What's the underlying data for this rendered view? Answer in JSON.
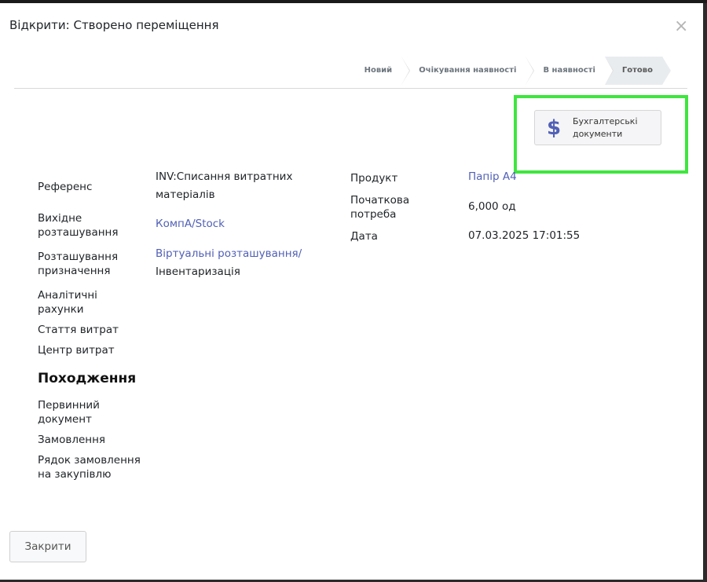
{
  "dialog": {
    "title": "Відкрити: Створено переміщення",
    "close_icon": "×"
  },
  "statusbar": {
    "stages": [
      {
        "label": "Новий",
        "active": false
      },
      {
        "label": "Очікування наявності",
        "active": false
      },
      {
        "label": "В наявності",
        "active": false
      },
      {
        "label": "Готово",
        "active": true
      }
    ]
  },
  "smart_button": {
    "icon": "$",
    "label_line1": "Бухгалтерські",
    "label_line2": "документи"
  },
  "left_fields": {
    "reference_label": "Референс",
    "reference_value_line1": "INV:Списання витратних",
    "reference_value_line2": "матеріалів",
    "source_location_label_line1": "Вихідне",
    "source_location_label_line2": "розташування",
    "source_location_value": "КомпА/Stock",
    "dest_location_label_line1": "Розташування",
    "dest_location_label_line2": "призначення",
    "dest_location_value_line1": "Віртуальні розташування/",
    "dest_location_value_line2": "Інвентаризація",
    "analytic_label_line1": "Аналітичні",
    "analytic_label_line2": "рахунки",
    "expense_item_label": "Стаття витрат",
    "cost_center_label": "Центр витрат"
  },
  "right_fields": {
    "product_label": "Продукт",
    "product_value": "Папір А4",
    "initial_demand_label_line1": "Початкова",
    "initial_demand_label_line2": "потреба",
    "initial_demand_value": "6,000 од",
    "date_label": "Дата",
    "date_value": "07.03.2025 17:01:55"
  },
  "origin_section": {
    "title": "Походження",
    "source_document_label_line1": "Первинний",
    "source_document_label_line2": "документ",
    "order_label": "Замовлення",
    "purchase_line_label_line1": "Рядок замовлення",
    "purchase_line_label_line2": "на закупівлю"
  },
  "footer": {
    "close_button": "Закрити"
  },
  "colors": {
    "link": "#5160b6",
    "highlight": "#3ee63e",
    "active_stage": "#e9ecef"
  }
}
